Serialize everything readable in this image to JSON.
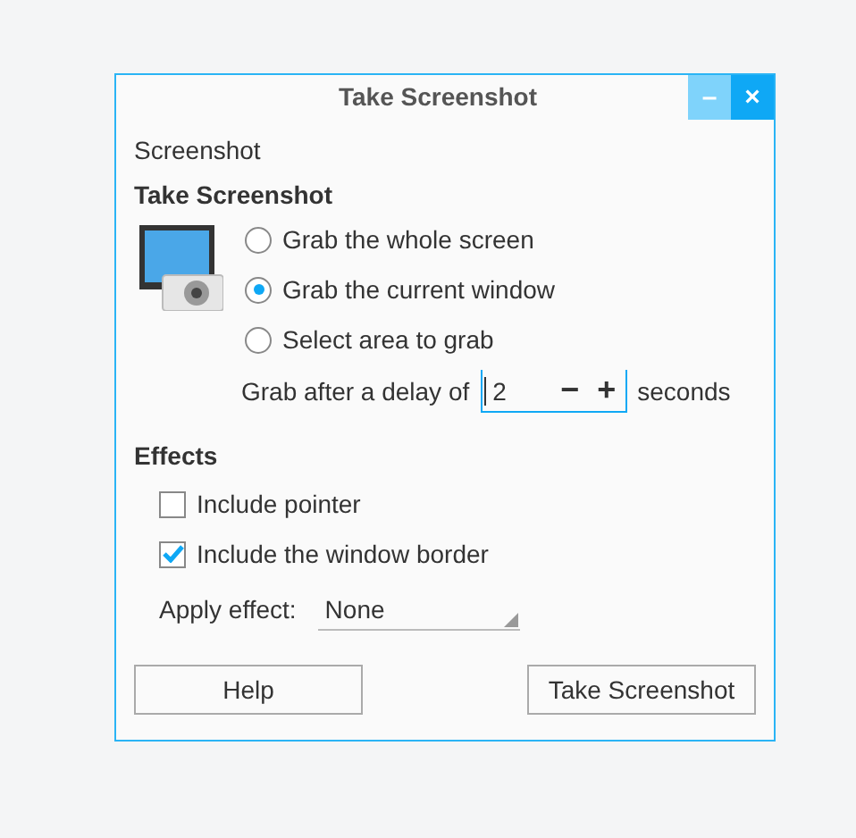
{
  "window": {
    "title": "Take Screenshot",
    "controls": [
      "–",
      "×"
    ]
  },
  "menu_label": "Screenshot",
  "capture": {
    "heading": "Take Screenshot",
    "modes": [
      {
        "label": "Grab the whole screen",
        "selected": false
      },
      {
        "label": "Grab the current window",
        "selected": true
      },
      {
        "label": "Select area to grab",
        "selected": false
      }
    ],
    "delay": {
      "label": "Grab after a delay of",
      "value": "2",
      "decrement": "−",
      "increment": "+",
      "unit": "seconds"
    }
  },
  "effects": {
    "heading": "Effects",
    "options": [
      {
        "label": "Include pointer",
        "checked": false
      },
      {
        "label": "Include the window border",
        "checked": true
      }
    ],
    "apply_label": "Apply effect:",
    "apply_value": "None"
  },
  "buttons": [
    "Help",
    "Take Screenshot"
  ]
}
